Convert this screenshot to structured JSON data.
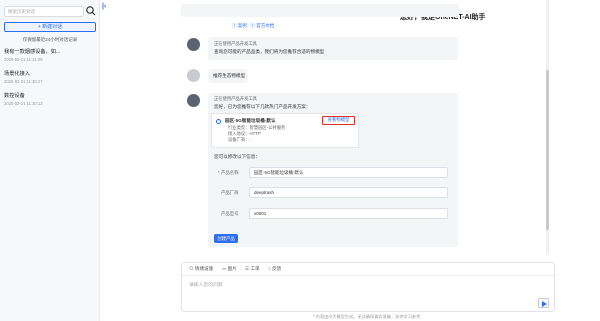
{
  "sidebar": {
    "search_placeholder": "搜索历史对话",
    "new_chat_label": "+ 新建对话",
    "note": "仅保留最近24小时对话记录",
    "conversations": [
      {
        "title": "我有一款烟感设备，如...",
        "date": "2025-02-21 11:31:08"
      },
      {
        "title": "场景化接入",
        "date": "2025-02-21 11:30:27"
      },
      {
        "title": "数控设备",
        "date": "2025-02-21 11:30:12"
      }
    ]
  },
  "chat": {
    "title": "您好，我是OneNET-AI助手",
    "top_links": [
      "① 案例",
      "① 官方文档"
    ],
    "messages": {
      "ai1_status": "正在使用产品开发工具",
      "ai1_text": "查询您可能的产品品类，我们将为您推荐合适的物模型",
      "user_text": "推荐生态物模型",
      "ai2_status": "正在使用产品开发工具",
      "ai2_text": "您好，已为您推荐以下几款热门产品开发方案：",
      "product": {
        "name": "园区-5G智能垃圾桶-默认",
        "industry": "行业类型：智慧园区-公共服务",
        "protocol": "接入协议：HTTP",
        "vendor": "设备厂商：-"
      },
      "view_button": "查看物模型",
      "form_intro": "您可以修改以下信息：",
      "form": {
        "product_name_label": "* 产品名称",
        "product_name_value": "园区-5G智能垃圾桶-默认",
        "vendor_label": "产品厂商",
        "vendor_value": "deeptrash",
        "model_label": "产品型号",
        "model_value": "v0001"
      },
      "create_button": "创建产品"
    }
  },
  "composer": {
    "tools": [
      "⊙ 情绪设施",
      "▭ 图片",
      "☰ 工单",
      "⌂ 反馈"
    ],
    "placeholder": "请输入您的问题",
    "footer": "* 内容由AI大模型生成，无法确保真实准确，仅供学习参考"
  },
  "colors": {
    "accent": "#2c6df6",
    "highlight_border": "#e0302a"
  }
}
